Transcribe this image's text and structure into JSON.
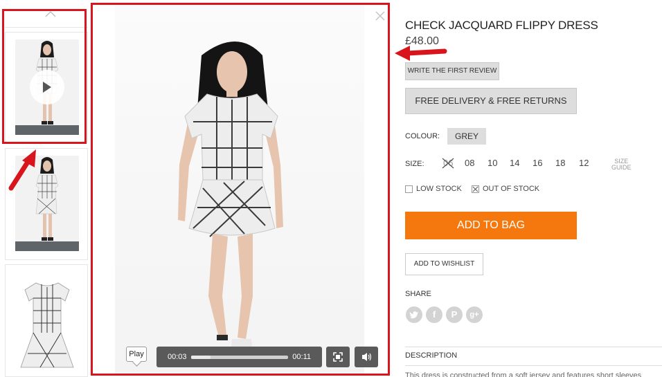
{
  "product": {
    "title": "CHECK JACQUARD FLIPPY DRESS",
    "price": "£48.00",
    "review_button": "WRITE THE FIRST REVIEW",
    "delivery_button": "FREE DELIVERY & FREE RETURNS",
    "colour_label": "COLOUR:",
    "colour_value": "GREY",
    "size_label": "SIZE:",
    "sizes": [
      "06",
      "08",
      "10",
      "14",
      "16",
      "18",
      "12"
    ],
    "unavailable_size": "06",
    "size_guide_line1": "SIZE",
    "size_guide_line2": "GUIDE",
    "low_stock_label": "LOW STOCK",
    "out_of_stock_label": "OUT OF STOCK",
    "add_to_bag": "ADD TO BAG",
    "add_to_wishlist": "ADD TO WISHLIST",
    "share_label": "SHARE",
    "social_icons": [
      "twitter-icon",
      "facebook-icon",
      "pinterest-icon",
      "google-plus-icon"
    ],
    "description_label": "DESCRIPTION",
    "description_text": "This dress is constructed from a soft jersey and features short sleeves"
  },
  "video": {
    "tooltip": "Play",
    "current_time": "00:03",
    "duration": "00:11",
    "progress_fraction": 0.2
  },
  "thumbnails": [
    {
      "type": "video",
      "alt": "model front view with play button"
    },
    {
      "type": "image",
      "alt": "model standing view"
    },
    {
      "type": "image",
      "alt": "dress flat view"
    }
  ],
  "colors": {
    "accent": "#f5780e",
    "annotation_red": "#d8141c",
    "chip_grey": "#dddddd"
  }
}
